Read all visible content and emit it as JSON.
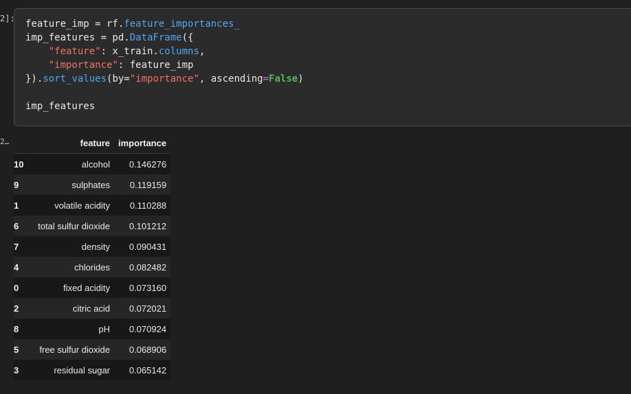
{
  "cell": {
    "in_prompt": "2]:",
    "out_prompt": "2…",
    "code": [
      [
        {
          "t": "feature_imp = rf.",
          "c": "plain"
        },
        {
          "t": "feature_importances_",
          "c": "attr"
        }
      ],
      [
        {
          "t": "imp_features = pd.",
          "c": "plain"
        },
        {
          "t": "DataFrame",
          "c": "attr"
        },
        {
          "t": "({",
          "c": "plain"
        }
      ],
      [
        {
          "t": "    ",
          "c": "plain"
        },
        {
          "t": "\"feature\"",
          "c": "str"
        },
        {
          "t": ": x_train.",
          "c": "plain"
        },
        {
          "t": "columns",
          "c": "attr"
        },
        {
          "t": ",",
          "c": "plain"
        }
      ],
      [
        {
          "t": "    ",
          "c": "plain"
        },
        {
          "t": "\"importance\"",
          "c": "str"
        },
        {
          "t": ": feature_imp",
          "c": "plain"
        }
      ],
      [
        {
          "t": "}).",
          "c": "plain"
        },
        {
          "t": "sort_values",
          "c": "attr"
        },
        {
          "t": "(by=",
          "c": "plain"
        },
        {
          "t": "\"importance\"",
          "c": "str"
        },
        {
          "t": ", ascending",
          "c": "plain"
        },
        {
          "t": "=",
          "c": "op"
        },
        {
          "t": "False",
          "c": "kw"
        },
        {
          "t": ")",
          "c": "plain"
        }
      ],
      [],
      [
        {
          "t": "imp_features",
          "c": "plain"
        }
      ]
    ]
  },
  "table": {
    "headers": [
      "",
      "feature",
      "importance"
    ],
    "rows": [
      {
        "index": "10",
        "feature": "alcohol",
        "importance": "0.146276"
      },
      {
        "index": "9",
        "feature": "sulphates",
        "importance": "0.119159"
      },
      {
        "index": "1",
        "feature": "volatile acidity",
        "importance": "0.110288"
      },
      {
        "index": "6",
        "feature": "total sulfur dioxide",
        "importance": "0.101212"
      },
      {
        "index": "7",
        "feature": "density",
        "importance": "0.090431"
      },
      {
        "index": "4",
        "feature": "chlorides",
        "importance": "0.082482"
      },
      {
        "index": "0",
        "feature": "fixed acidity",
        "importance": "0.073160"
      },
      {
        "index": "2",
        "feature": "citric acid",
        "importance": "0.072021"
      },
      {
        "index": "8",
        "feature": "pH",
        "importance": "0.070924"
      },
      {
        "index": "5",
        "feature": "free sulfur dioxide",
        "importance": "0.068906"
      },
      {
        "index": "3",
        "feature": "residual sugar",
        "importance": "0.065142"
      }
    ]
  }
}
